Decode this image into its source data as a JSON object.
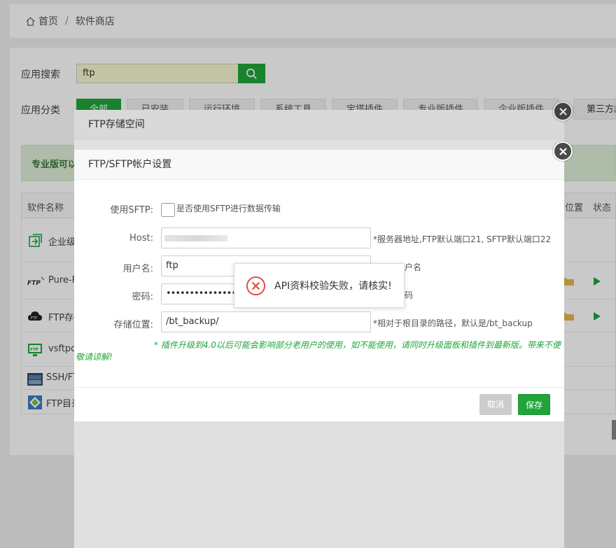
{
  "breadcrumb": {
    "home": "首页",
    "separator": "/",
    "current": "软件商店"
  },
  "search": {
    "label": "应用搜索",
    "value": "ftp"
  },
  "category": {
    "label": "应用分类",
    "items": [
      "全部",
      "已安装",
      "运行环境",
      "系统工具",
      "宝塔插件",
      "专业版插件",
      "企业版插件"
    ],
    "third_party": "第三方应"
  },
  "promo": {
    "text": "专业版可以"
  },
  "table": {
    "headers": {
      "name": "软件名称",
      "position": "位置",
      "status": "状态"
    },
    "rows": [
      {
        "icon": "enterprise-icon",
        "name": "企业级"
      },
      {
        "icon": "ftp-logo-icon",
        "logo_text": "FTP",
        "name": "Pure-F"
      },
      {
        "icon": "cloud-ftp-icon",
        "logo_text": "FTP",
        "name": "FTP存储"
      },
      {
        "icon": "monitor-ftp-icon",
        "logo_text": "FTP",
        "name": "vsftpd"
      },
      {
        "icon": "ssh-icon",
        "name": "SSH/FT"
      },
      {
        "icon": "ftp-directory-icon",
        "name": "FTP目录"
      }
    ]
  },
  "dialog_outer": {
    "title": "FTP存储空间"
  },
  "dialog": {
    "title": "FTP/SFTP帐户设置",
    "sftp": {
      "label": "使用SFTP:",
      "hint": "是否使用SFTP进行数据传输",
      "checked": false
    },
    "host": {
      "label": "Host:",
      "hint": "*服务器地址,FTP默认端口21, SFTP默认端口22"
    },
    "username": {
      "label": "用户名:",
      "value": "ftp",
      "hint": "户名"
    },
    "password": {
      "label": "密码:",
      "value": "••••••••••••••••",
      "hint": "码"
    },
    "storage": {
      "label": "存储位置:",
      "value": "/bt_backup/",
      "hint": "*相对于根目录的路径，默认是/bt_backup"
    },
    "warning": "* 插件升级到4.0以后可能会影响部分老用户的使用，如不能使用，请同时升级面板和插件到最新版。带来不便敬请谅解!",
    "cancel_label": "取消",
    "save_label": "保存"
  },
  "toast": {
    "message": "API资料校验失败，请核实!",
    "icon": "error-icon"
  },
  "colors": {
    "accent": "#20a53a",
    "error": "#e6473a"
  }
}
